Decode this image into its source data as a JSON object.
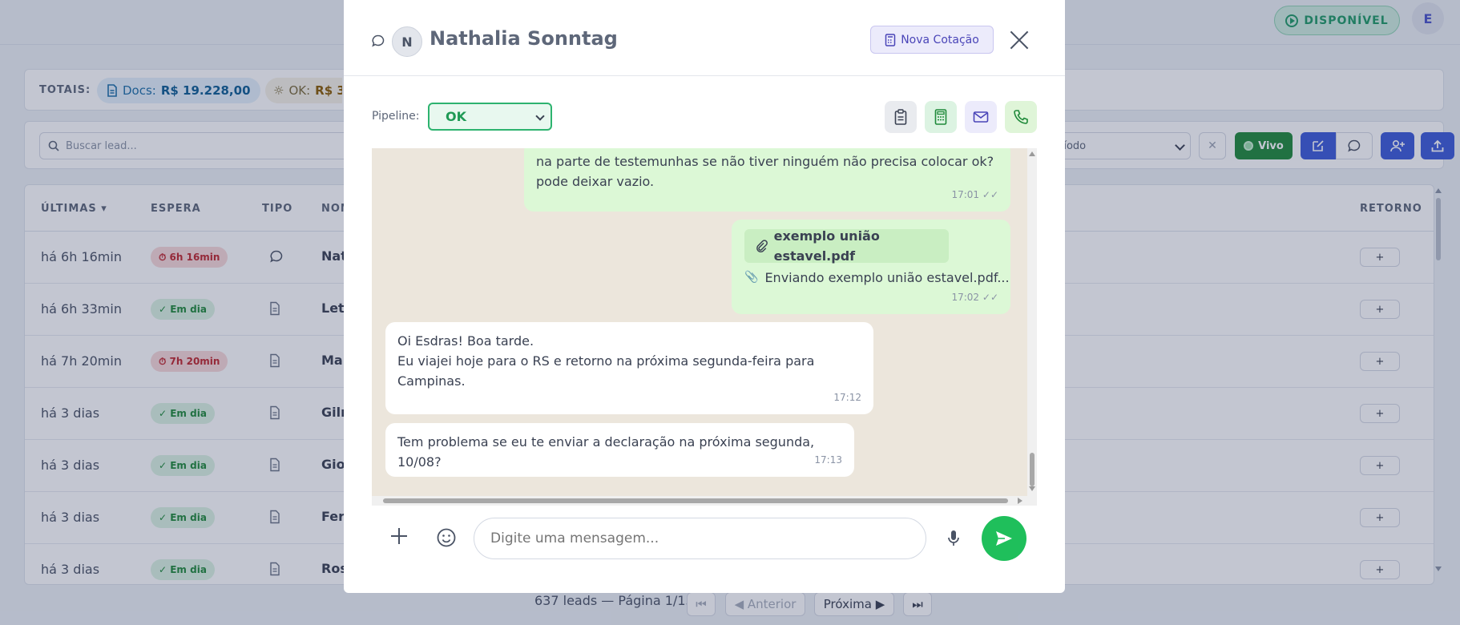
{
  "topbar": {
    "status_label": "DISPONÍVEL",
    "user_initial": "E"
  },
  "totals": {
    "label": "TOTAIS:",
    "docs_label": "Docs:",
    "docs_value": "R$ 19.228,00",
    "ok_label": "OK:",
    "ok_value": "R$ 3"
  },
  "filters": {
    "search_placeholder": "Buscar lead...",
    "period_label": "ríodo",
    "clear_label": "✕",
    "live_label": "Vivo"
  },
  "table": {
    "headers": [
      "ÚLTIMAS ▾",
      "ESPERA",
      "TIPO",
      "NOM",
      "RETORNO"
    ],
    "rows": [
      {
        "time": "há 6h 16min",
        "wait": "⏱ 6h 16min",
        "wait_status": "late",
        "type": "chat",
        "name": "Nat",
        "ret": "+"
      },
      {
        "time": "há 6h 33min",
        "wait": "✓ Em dia",
        "wait_status": "ok",
        "type": "doc",
        "name": "Leti",
        "ret": "+"
      },
      {
        "time": "há 7h 20min",
        "wait": "⏱ 7h 20min",
        "wait_status": "late",
        "type": "doc",
        "name": "Mar",
        "ret": "+"
      },
      {
        "time": "há 3 dias",
        "wait": "✓ Em dia",
        "wait_status": "ok",
        "type": "doc",
        "name": "Gilr",
        "ret": "+"
      },
      {
        "time": "há 3 dias",
        "wait": "✓ Em dia",
        "wait_status": "ok",
        "type": "doc",
        "name": "Giov",
        "ret": "+"
      },
      {
        "time": "há 3 dias",
        "wait": "✓ Em dia",
        "wait_status": "ok",
        "type": "doc",
        "name": "Fern",
        "ret": "+"
      },
      {
        "time": "há 3 dias",
        "wait": "✓ Em dia",
        "wait_status": "ok",
        "type": "doc",
        "name": "Ros",
        "ret": "+"
      }
    ]
  },
  "pagination": {
    "summary": "637 leads — Página 1/13",
    "first": "⏮",
    "prev": "◀ Anterior",
    "next": "Próxima ▶",
    "last": "⏭"
  },
  "modal": {
    "contact_initial": "N",
    "contact_name": "Nathalia Sonntag",
    "new_quote_label": "Nova Cotação",
    "pipeline_label": "Pipeline:",
    "pipeline_value": "OK",
    "messages": [
      {
        "dir": "out",
        "lines": [
          "na parte de testemunhas se não tiver ninguém não precisa colocar ok?",
          "pode deixar vazio."
        ],
        "time": "17:01",
        "ticks": "✓✓"
      },
      {
        "dir": "out",
        "attachment": "exemplo união estavel.pdf",
        "lines": [
          "Enviando exemplo união estavel.pdf..."
        ],
        "time": "17:02",
        "ticks": "✓✓"
      },
      {
        "dir": "in",
        "lines": [
          "Oi Esdras! Boa tarde.",
          "Eu viajei hoje para o RS e retorno na próxima segunda-feira para",
          "Campinas."
        ],
        "time": "17:12"
      },
      {
        "dir": "in",
        "lines": [
          "Tem problema se eu te enviar a declaração na próxima segunda, 10/08?"
        ],
        "time": "17:13"
      }
    ],
    "composer_placeholder": "Digite uma mensagem..."
  },
  "colors": {
    "accent": "#3c5bd9",
    "whatsapp_green": "#1fbf5b",
    "outgoing_bubble": "#dcf8d6",
    "chat_background": "#ece6dc"
  }
}
